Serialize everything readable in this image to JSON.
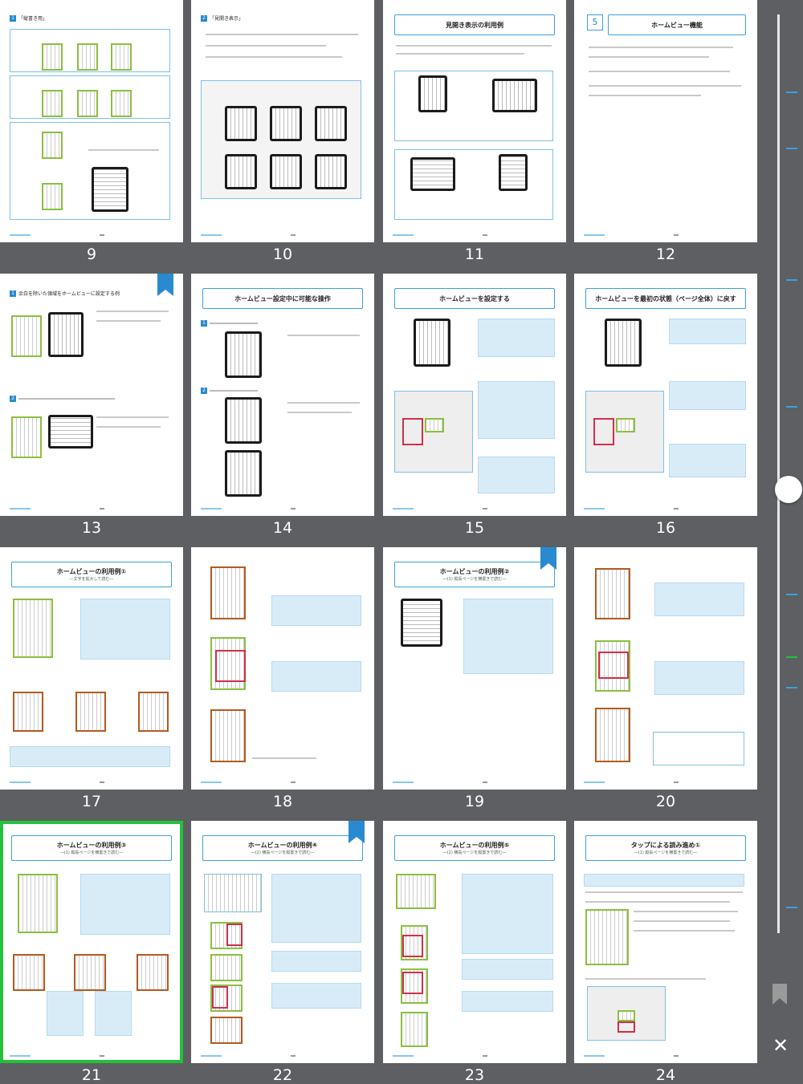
{
  "pages": [
    {
      "number": "9",
      "title": "「縦書き用」",
      "bookmarked": false,
      "selected": false
    },
    {
      "number": "10",
      "title": "「見開き表示」",
      "bookmarked": false,
      "selected": false
    },
    {
      "number": "11",
      "title": "見開き表示の利用例",
      "bookmarked": false,
      "selected": false
    },
    {
      "number": "12",
      "title": "ホームビュー機能",
      "bookmarked": false,
      "selected": false
    },
    {
      "number": "13",
      "title": "余白を除いた領域をホームビューに設定する例",
      "bookmarked": true,
      "selected": false
    },
    {
      "number": "14",
      "title": "ホームビュー設定中に可能な操作",
      "bookmarked": false,
      "selected": false
    },
    {
      "number": "15",
      "title": "ホームビューを設定する",
      "bookmarked": false,
      "selected": false
    },
    {
      "number": "16",
      "title": "ホームビューを最初の状態（ページ全体）に戻す",
      "bookmarked": false,
      "selected": false
    },
    {
      "number": "17",
      "title": "ホームビューの利用例①",
      "subtitle": "―文字を拡大して読む―",
      "bookmarked": false,
      "selected": false
    },
    {
      "number": "18",
      "title": "",
      "bookmarked": false,
      "selected": false
    },
    {
      "number": "19",
      "title": "ホームビューの利用例②",
      "subtitle": "―(1) 縦長ページを横置きで読む―",
      "bookmarked": true,
      "selected": false
    },
    {
      "number": "20",
      "title": "",
      "bookmarked": false,
      "selected": false
    },
    {
      "number": "21",
      "title": "ホームビューの利用例③",
      "subtitle": "―(1) 縦長ページを横置きで読む―",
      "bookmarked": false,
      "selected": true
    },
    {
      "number": "22",
      "title": "ホームビューの利用例④",
      "subtitle": "―(2) 横長ページを縦置きで読む―",
      "bookmarked": true,
      "selected": false
    },
    {
      "number": "23",
      "title": "ホームビューの利用例⑤",
      "subtitle": "―(2) 横長ページを縦置きで読む―",
      "bookmarked": false,
      "selected": false
    },
    {
      "number": "24",
      "title": "タップによる読み進め①",
      "subtitle": "―(1) 縦長ページを横置きで読む―",
      "bookmarked": false,
      "selected": false
    }
  ],
  "section_number_12": "5",
  "scrollbar": {
    "position_fraction": 0.5
  },
  "controls": {
    "bookmark_icon": "bookmark-icon",
    "close_label": "✕"
  },
  "colors": {
    "accent": "#3aa0e0",
    "selected": "#22c23a",
    "background": "#5d5f63"
  }
}
